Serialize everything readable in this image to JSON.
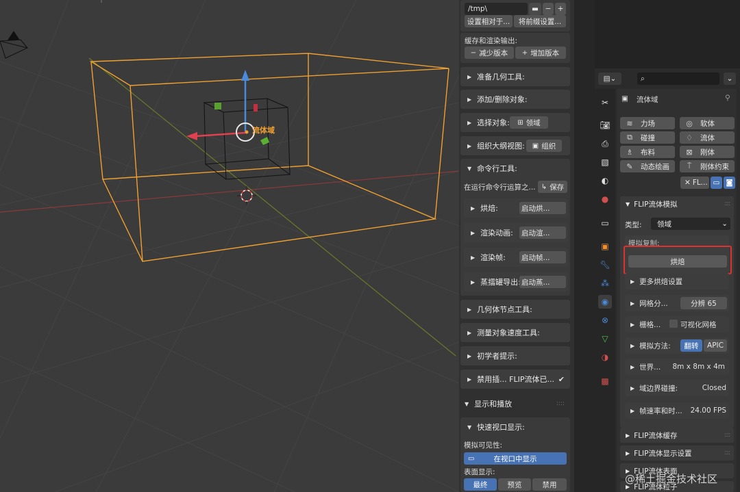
{
  "viewport": {
    "object_label": "流体域"
  },
  "npanel": {
    "path_value": "/tmp\\",
    "set_relative_btn": "设置相对于...",
    "set_prefix_btn": "将前缀设置...",
    "cache_render_label": "缓存和渲染输出:",
    "decrease_version": "减少版本",
    "increase_version": "增加版本",
    "prepare_geometry": "准备几何工具:",
    "add_remove_objects": "添加/删除对象:",
    "select_objects_label": "选择对象:",
    "select_objects_btn": "领域",
    "organize_outliner_label": "组织大纲视图:",
    "organize_btn": "组织",
    "cmdline_tools": "命令行工具:",
    "cmdline_run_label": "在运行命令行运算之...",
    "save_btn": "保存",
    "bake_label": "烘焙:",
    "bake_btn": "启动烘...",
    "render_anim_label": "渲染动画:",
    "render_anim_btn": "启动渲...",
    "render_frame_label": "渲染帧:",
    "render_frame_btn": "启动帧...",
    "alembic_label": "蒸擂罐导出:",
    "alembic_btn": "启动蒸...",
    "geo_nodes_tools": "几何体节点工具:",
    "measure_velocity": "测量对象速度工具:",
    "beginner_tips": "初学者提示:",
    "disable_addon": "禁用插... FLIP流体已...",
    "display_playback": "显示和播放",
    "quick_viewport": "快速视口显示:",
    "sim_visibility_label": "模拟可见性:",
    "show_in_viewport": "在视口中显示",
    "surface_display_label": "表面显示:",
    "surface_opts": [
      "最终",
      "预览",
      "禁用"
    ]
  },
  "properties": {
    "object_name": "流体域",
    "physics_btns": [
      {
        "label": "力场",
        "icon": "force-field-icon"
      },
      {
        "label": "软体",
        "icon": "softbody-icon"
      },
      {
        "label": "碰撞",
        "icon": "collision-icon"
      },
      {
        "label": "流体",
        "icon": "fluid-icon"
      },
      {
        "label": "布料",
        "icon": "cloth-icon"
      },
      {
        "label": "刚体",
        "icon": "rigidbody-icon"
      },
      {
        "label": "动态绘画",
        "icon": "dynamic-paint-icon"
      },
      {
        "label": "刚体约束",
        "icon": "rigidbody-constraint-icon"
      }
    ],
    "flip_short": "FL...",
    "flip_sim_title": "FLIP流体模拟",
    "type_label": "类型:",
    "type_value": "领域",
    "sim_copy_label": "模拟复制:",
    "bake_btn": "烘焙",
    "more_bake": "更多烘焙设置",
    "grid_res_label": "网格分...",
    "grid_res_value": "分辨 65",
    "grid_label": "栅格...",
    "visualize_grid": "可视化网格",
    "sim_method_label": "模拟方法:",
    "sim_method_opts": [
      "翻转",
      "APIC"
    ],
    "world_label": "世界...",
    "world_value": "8m  x  8m  x  4m",
    "boundary_label": "域边界碰撞:",
    "boundary_value": "Closed",
    "fps_label": "帧速率和时...",
    "fps_value": "24.00 FPS",
    "cache_title": "FLIP流体缓存",
    "display_title": "FLIP流体显示设置",
    "surface_title": "FLIP流体表面",
    "particles_title": "FLIP流体粒子"
  },
  "watermark": "@稀土掘金技术社区",
  "colors": {
    "accent_blue": "#4772b3",
    "highlight_red": "#e03030",
    "selection_orange": "#f0a030"
  }
}
